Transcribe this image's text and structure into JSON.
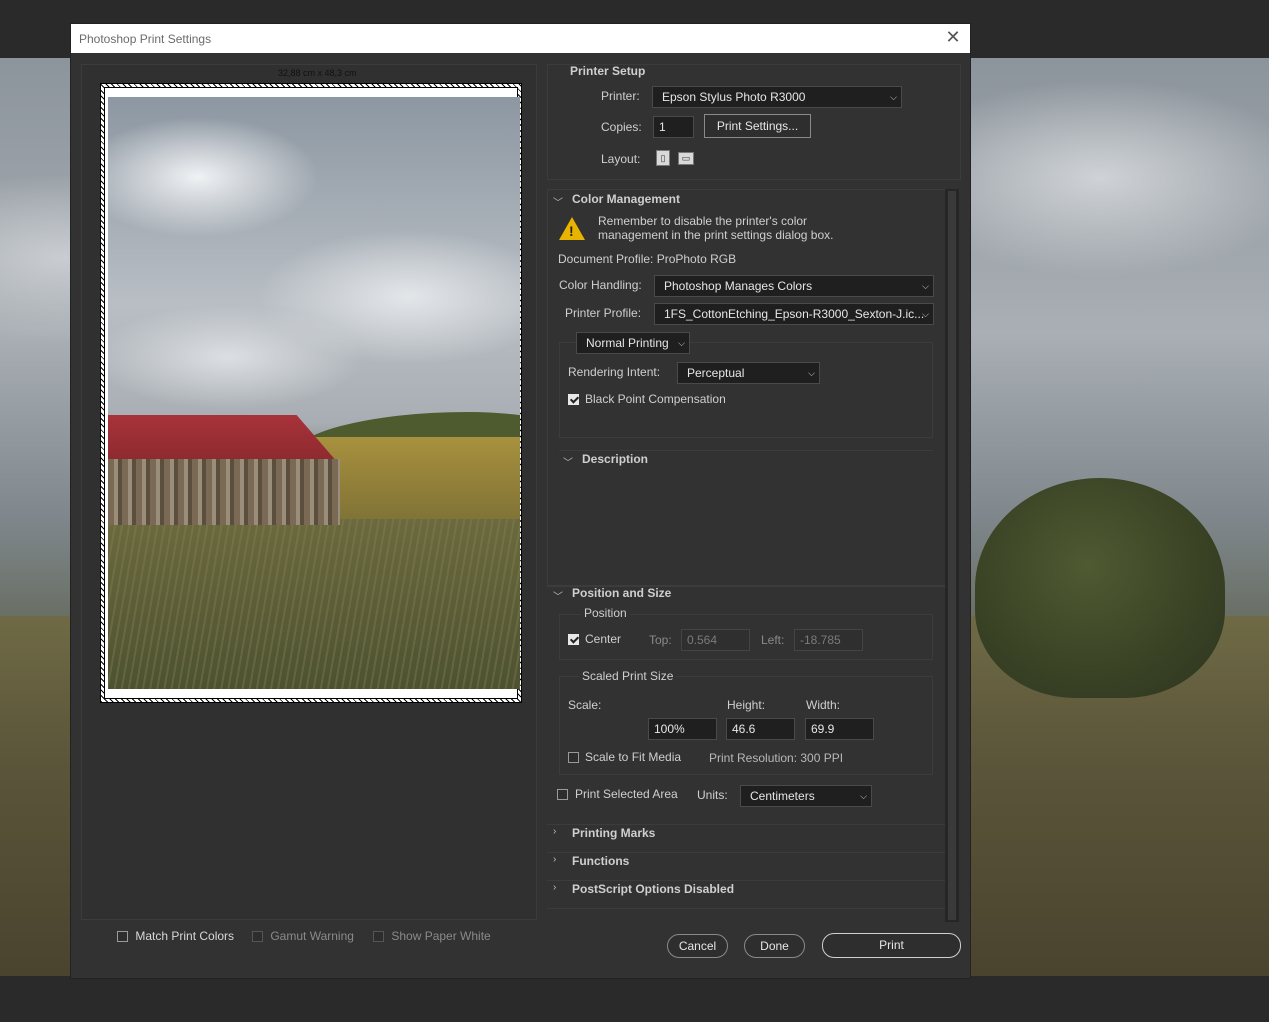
{
  "dialog": {
    "title": "Photoshop Print Settings",
    "close_icon": "close-icon"
  },
  "preview": {
    "paper_size_label": "32,88 cm x 48,3 cm"
  },
  "bottom_options": {
    "match_print_colors": {
      "label": "Match Print Colors",
      "checked": false
    },
    "gamut_warning": {
      "label": "Gamut Warning",
      "checked": false,
      "enabled": false
    },
    "show_paper_white": {
      "label": "Show Paper White",
      "checked": false,
      "enabled": false
    }
  },
  "printer_setup": {
    "heading": "Printer Setup",
    "printer_label": "Printer:",
    "printer_value": "Epson Stylus Photo R3000",
    "copies_label": "Copies:",
    "copies_value": "1",
    "print_settings_button": "Print Settings...",
    "layout_label": "Layout:",
    "layout_icons": [
      "portrait-layout-icon",
      "landscape-layout-icon"
    ]
  },
  "color_management": {
    "heading": "Color Management",
    "warning_text_1": "Remember to disable the printer's color",
    "warning_text_2": "management in the print settings dialog box.",
    "document_profile": "Document Profile: ProPhoto RGB",
    "color_handling_label": "Color Handling:",
    "color_handling_value": "Photoshop Manages Colors",
    "printer_profile_label": "Printer Profile:",
    "printer_profile_value": "1FS_CottonEtching_Epson-R3000_Sexton-J.ic...",
    "printing_mode": "Normal Printing",
    "rendering_intent_label": "Rendering Intent:",
    "rendering_intent_value": "Perceptual",
    "black_point_label": "Black Point Compensation",
    "black_point_checked": true
  },
  "description": {
    "heading": "Description"
  },
  "position_size": {
    "heading": "Position and Size",
    "position_label": "Position",
    "center_label": "Center",
    "center_checked": true,
    "top_label": "Top:",
    "top_value": "0.564",
    "left_label": "Left:",
    "left_value": "-18.785",
    "scaled_label": "Scaled Print Size",
    "scale_label": "Scale:",
    "height_label": "Height:",
    "width_label": "Width:",
    "scale_value": "100%",
    "height_value": "46.6",
    "width_value": "69.9",
    "scale_to_fit_label": "Scale to Fit Media",
    "scale_to_fit_checked": false,
    "print_resolution": "Print Resolution: 300 PPI",
    "print_selected_label": "Print Selected Area",
    "print_selected_checked": false,
    "units_label": "Units:",
    "units_value": "Centimeters"
  },
  "collapsed_sections": {
    "printing_marks": "Printing Marks",
    "functions": "Functions",
    "postscript": "PostScript Options Disabled"
  },
  "actions": {
    "cancel": "Cancel",
    "done": "Done",
    "print": "Print"
  }
}
